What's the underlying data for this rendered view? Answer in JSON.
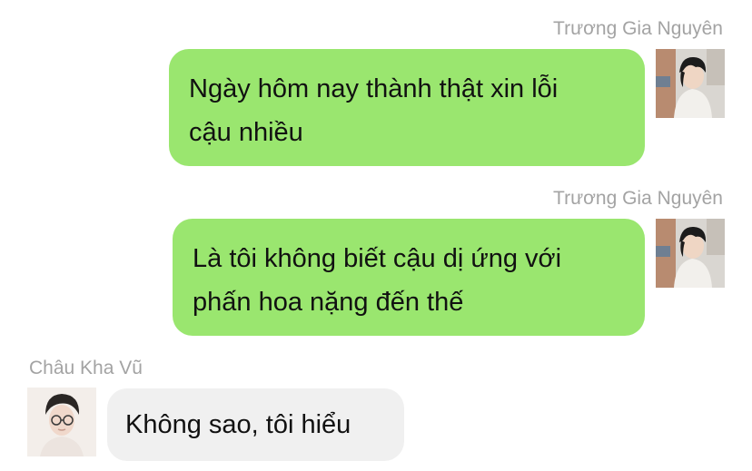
{
  "messages": [
    {
      "sender": "Trương Gia Nguyên",
      "side": "right",
      "lines": [
        "Ngày hôm nay thành thật xin lỗi",
        "cậu nhiều"
      ]
    },
    {
      "sender": "Trương Gia Nguyên",
      "side": "right",
      "lines": [
        "Là tôi không biết cậu dị ứng với",
        "phấn hoa nặng đến thế"
      ]
    },
    {
      "sender": "Châu Kha Vũ",
      "side": "left",
      "lines": [
        "Không sao, tôi hiểu"
      ]
    }
  ],
  "colors": {
    "outgoing_bubble": "#9ae66f",
    "incoming_bubble": "#f0f0f0",
    "sender_name": "#a3a3a3",
    "text": "#111111"
  },
  "icons": {
    "outgoing_avatar": "avatar-photo",
    "incoming_avatar": "avatar-photo"
  }
}
